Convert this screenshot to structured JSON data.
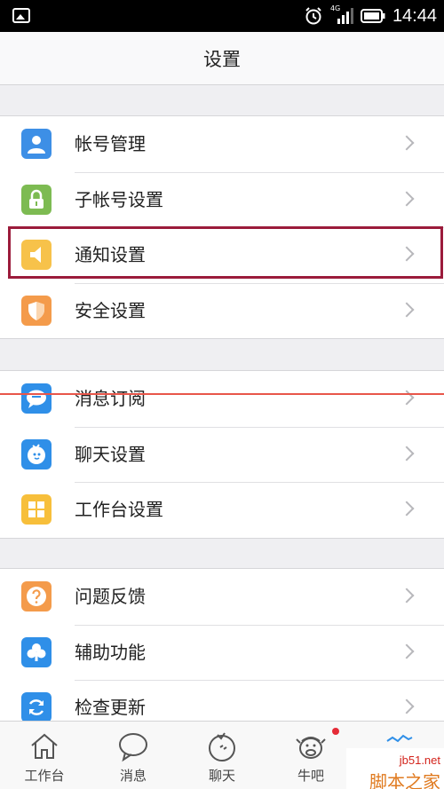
{
  "status_bar": {
    "time": "14:44",
    "network": "4G"
  },
  "header": {
    "title": "设置"
  },
  "groups": [
    {
      "items": [
        {
          "label": "帐号管理",
          "icon": "person-icon",
          "color": "#3d8fe6"
        },
        {
          "label": "子帐号设置",
          "icon": "lock-icon",
          "color": "#7dbb52"
        },
        {
          "label": "通知设置",
          "icon": "speaker-icon",
          "color": "#f7c24a"
        },
        {
          "label": "安全设置",
          "icon": "shield-icon",
          "color": "#f49b4b"
        }
      ]
    },
    {
      "items": [
        {
          "label": "消息订阅",
          "icon": "message-bubble-icon",
          "color": "#2f8fe8"
        },
        {
          "label": "聊天设置",
          "icon": "chat-face-icon",
          "color": "#2f8fe8"
        },
        {
          "label": "工作台设置",
          "icon": "grid-icon",
          "color": "#f7bf3b"
        }
      ]
    },
    {
      "items": [
        {
          "label": "问题反馈",
          "icon": "question-icon",
          "color": "#f49b4b"
        },
        {
          "label": "辅助功能",
          "icon": "club-icon",
          "color": "#2f8fe8"
        },
        {
          "label": "检查更新",
          "icon": "refresh-icon",
          "color": "#2f8fe8"
        }
      ]
    }
  ],
  "tabs": [
    {
      "label": "工作台",
      "icon": "house-icon"
    },
    {
      "label": "消息",
      "icon": "speech-bubble-icon"
    },
    {
      "label": "聊天",
      "icon": "chat-icon"
    },
    {
      "label": "牛吧",
      "icon": "cow-icon"
    },
    {
      "label": "",
      "icon": "settings-tab-icon"
    }
  ],
  "watermark": {
    "line1": "jb51.net",
    "line2": "脚本之家"
  }
}
